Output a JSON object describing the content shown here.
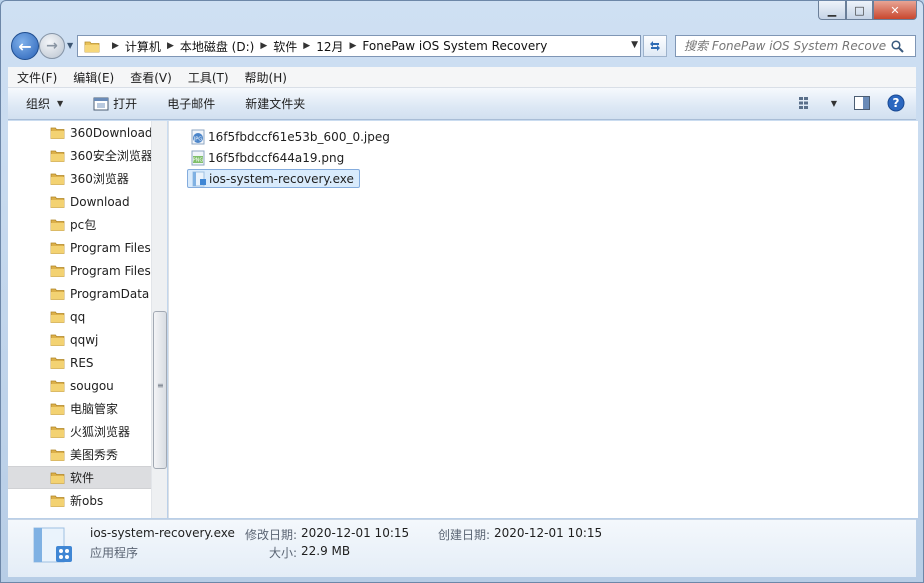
{
  "window": {
    "caption_buttons": {
      "minimize": "▁",
      "maximize": "□",
      "close": "✕"
    }
  },
  "nav": {
    "back_icon": "←",
    "forward_icon": "→",
    "breadcrumbs": [
      "计算机",
      "本地磁盘 (D:)",
      "软件",
      "12月",
      "FonePaw iOS System Recovery"
    ],
    "search_placeholder": "搜索 FonePaw iOS System Recovery"
  },
  "menu": {
    "items": [
      "文件(F)",
      "编辑(E)",
      "查看(V)",
      "工具(T)",
      "帮助(H)"
    ]
  },
  "toolbar": {
    "organize_label": "组织",
    "open_label": "打开",
    "email_label": "电子邮件",
    "new_folder_label": "新建文件夹"
  },
  "tree": {
    "items": [
      {
        "label": "360Download"
      },
      {
        "label": "360安全浏览器"
      },
      {
        "label": "360浏览器"
      },
      {
        "label": "Download"
      },
      {
        "label": "pc包"
      },
      {
        "label": "Program Files"
      },
      {
        "label": "Program Files"
      },
      {
        "label": "ProgramData"
      },
      {
        "label": "qq"
      },
      {
        "label": "qqwj"
      },
      {
        "label": "RES"
      },
      {
        "label": "sougou"
      },
      {
        "label": "电脑管家"
      },
      {
        "label": "火狐浏览器"
      },
      {
        "label": "美图秀秀"
      },
      {
        "label": "软件",
        "selected": true
      },
      {
        "label": "新obs"
      }
    ]
  },
  "files": {
    "items": [
      {
        "name": "16f5fbdccf61e53b_600_0.jpeg",
        "icon": "jpeg-file-icon"
      },
      {
        "name": "16f5fbdccf644a19.png",
        "icon": "png-file-icon"
      },
      {
        "name": "ios-system-recovery.exe",
        "icon": "exe-file-icon",
        "selected": true
      }
    ]
  },
  "details": {
    "file_name": "ios-system-recovery.exe",
    "file_type": "应用程序",
    "modified_label": "修改日期:",
    "modified_value": "2020-12-01 10:15",
    "created_label": "创建日期:",
    "created_value": "2020-12-01 10:15",
    "size_label": "大小:",
    "size_value": "22.9 MB"
  }
}
